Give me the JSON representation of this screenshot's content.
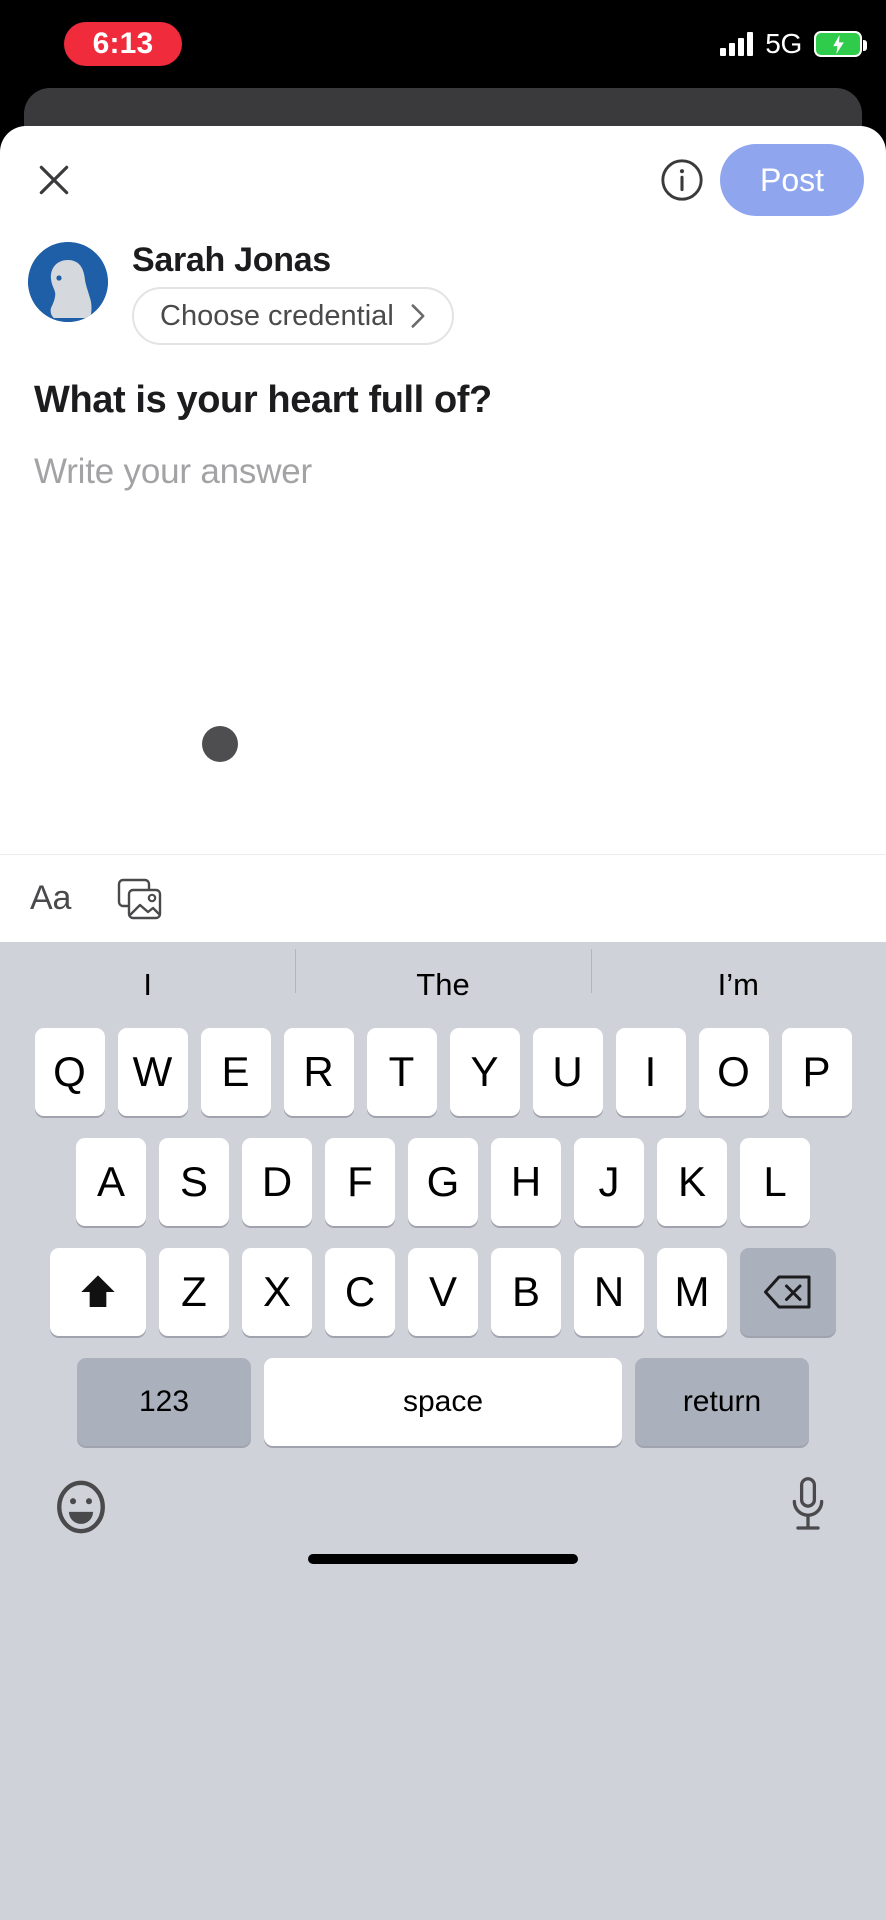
{
  "status_bar": {
    "time": "6:13",
    "recording_pill_color": "#f02b3c",
    "network": "5G",
    "battery_color": "#2ecc4a",
    "signal_icon": "cellular-bars-icon",
    "battery_icon": "battery-charging-icon"
  },
  "header": {
    "close_icon": "close-x-icon",
    "info_icon": "info-circle-icon",
    "post_label": "Post",
    "post_color": "#8fa6ef"
  },
  "author": {
    "name": "Sarah Jonas",
    "avatar_icon": "default-person-avatar-icon",
    "avatar_bg": "#1f5fa8",
    "credential_label": "Choose credential",
    "credential_chevron": "chevron-right-icon"
  },
  "composer": {
    "question": "What is your heart full of?",
    "answer_placeholder": "Write your answer",
    "answer_value": ""
  },
  "format_toolbar": {
    "text_format_label": "Aa",
    "text_format_icon": "text-format-icon",
    "image_icon": "photo-stack-icon"
  },
  "keyboard": {
    "suggestions": [
      "I",
      "The",
      "I’m"
    ],
    "row1": [
      "Q",
      "W",
      "E",
      "R",
      "T",
      "Y",
      "U",
      "I",
      "O",
      "P"
    ],
    "row2": [
      "A",
      "S",
      "D",
      "F",
      "G",
      "H",
      "J",
      "K",
      "L"
    ],
    "row3_letters": [
      "Z",
      "X",
      "C",
      "V",
      "B",
      "N",
      "M"
    ],
    "shift_icon": "shift-arrow-icon",
    "backspace_icon": "backspace-delete-icon",
    "numeric_label": "123",
    "space_label": "space",
    "return_label": "return",
    "emoji_icon": "emoji-smiley-icon",
    "mic_icon": "microphone-icon",
    "bg_color": "#d0d2d9",
    "special_key_color": "#aab0bc"
  }
}
